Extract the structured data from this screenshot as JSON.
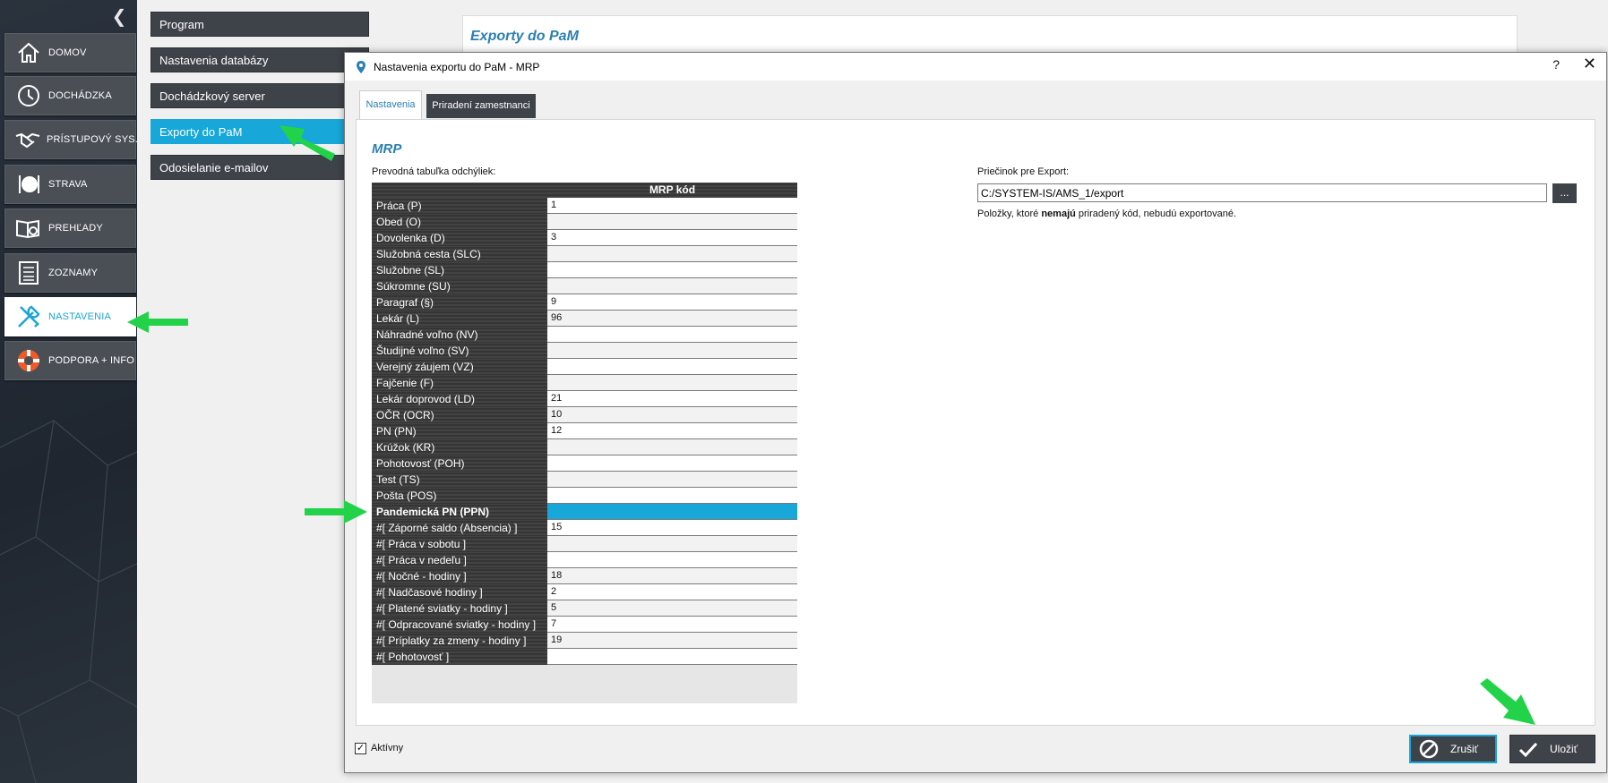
{
  "sidebar": {
    "items": [
      {
        "label": "DOMOV",
        "icon": "home-icon"
      },
      {
        "label": "DOCHÁDZKA",
        "icon": "clock-icon"
      },
      {
        "label": "PRÍSTUPOVÝ SYS.",
        "icon": "handshake-icon"
      },
      {
        "label": "STRAVA",
        "icon": "plate-cutlery-icon"
      },
      {
        "label": "PREHĽADY",
        "icon": "book-search-icon"
      },
      {
        "label": "ZOZNAMY",
        "icon": "list-icon"
      },
      {
        "label": "NASTAVENIA",
        "icon": "wrench-screwdriver-icon"
      },
      {
        "label": "PODPORA + INFO",
        "icon": "lifebuoy-icon"
      }
    ],
    "active": "NASTAVENIA"
  },
  "settings_menu": {
    "items": [
      {
        "label": "Program"
      },
      {
        "label": "Nastavenia databázy"
      },
      {
        "label": "Dochádzkový server"
      },
      {
        "label": "Exporty do PaM"
      },
      {
        "label": "Odosielanie e-mailov"
      }
    ],
    "active": "Exporty do PaM"
  },
  "page": {
    "title": "Exporty do PaM"
  },
  "dialog": {
    "title": "Nastavenia exportu do PaM - MRP",
    "help_label": "?",
    "close_label": "✕",
    "tabs": [
      {
        "label": "Nastavenia",
        "active": true
      },
      {
        "label": "Priradení zamestnanci",
        "active": false
      }
    ],
    "section_title": "MRP",
    "table_label": "Prevodná tabuľka odchýliek:",
    "table_header": "MRP kód",
    "rows": [
      {
        "name": "Práca   (P)",
        "value": "1"
      },
      {
        "name": "Obed   (O)",
        "value": ""
      },
      {
        "name": "Dovolenka   (D)",
        "value": "3"
      },
      {
        "name": "Služobná cesta   (SLC)",
        "value": ""
      },
      {
        "name": "Služobne   (SL)",
        "value": ""
      },
      {
        "name": "Súkromne   (SU)",
        "value": ""
      },
      {
        "name": "Paragraf   (§)",
        "value": "9"
      },
      {
        "name": "Lekár   (L)",
        "value": "96"
      },
      {
        "name": "Náhradné voľno   (NV)",
        "value": ""
      },
      {
        "name": "Študijné voľno   (SV)",
        "value": ""
      },
      {
        "name": "Verejný záujem   (VZ)",
        "value": ""
      },
      {
        "name": "Fajčenie   (F)",
        "value": ""
      },
      {
        "name": "Lekár doprovod   (LD)",
        "value": "21"
      },
      {
        "name": "OČR   (OCR)",
        "value": "10"
      },
      {
        "name": "PN   (PN)",
        "value": "12"
      },
      {
        "name": "Krúžok   (KR)",
        "value": ""
      },
      {
        "name": "Pohotovosť   (POH)",
        "value": ""
      },
      {
        "name": "Test   (TS)",
        "value": ""
      },
      {
        "name": "Pošta   (POS)",
        "value": ""
      },
      {
        "name": "Pandemická PN   (PPN)",
        "value": "",
        "selected": true
      },
      {
        "name": " #[ Záporné saldo (Absencia) ]",
        "value": "15"
      },
      {
        "name": " #[ Práca v sobotu ]",
        "value": ""
      },
      {
        "name": " #[ Práca v nedeľu ]",
        "value": ""
      },
      {
        "name": " #[ Nočné - hodiny ]",
        "value": "18"
      },
      {
        "name": " #[ Nadčasové hodiny ]",
        "value": "2"
      },
      {
        "name": " #[ Platené sviatky - hodiny ]",
        "value": "5"
      },
      {
        "name": " #[ Odpracované sviatky - hodiny ]",
        "value": "7"
      },
      {
        "name": " #[ Príplatky za zmeny - hodiny ]",
        "value": "19"
      },
      {
        "name": " #[ Pohotovosť ]",
        "value": ""
      }
    ],
    "folder": {
      "label": "Priečinok pre Export:",
      "value": "C:/SYSTEM-IS/AMS_1/export",
      "browse_label": "...",
      "note_prefix": "Položky, ktoré ",
      "note_bold": "nemajú",
      "note_suffix": " priradený kód, nebudú exportované."
    },
    "footer": {
      "active_label": "Aktívny",
      "active_checked": true,
      "check_mark": "✓",
      "cancel_label": "Zrušiť",
      "save_label": "Uložiť"
    }
  },
  "colors": {
    "accent": "#17a7d8",
    "title_blue": "#2b7fb3",
    "dark_button": "#3e4249",
    "arrow_green": "#22d34a"
  }
}
